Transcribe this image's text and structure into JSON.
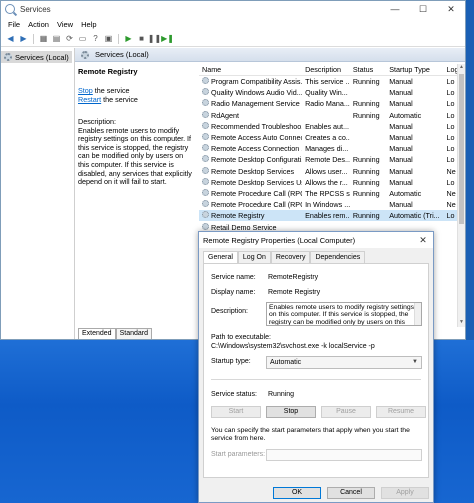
{
  "window": {
    "title": "Services",
    "controls": [
      "—",
      "☐",
      "✕"
    ]
  },
  "menu": [
    "File",
    "Action",
    "View",
    "Help"
  ],
  "tree": {
    "item": "Services (Local)"
  },
  "content_header": "Services (Local)",
  "detail": {
    "service_name": "Remote Registry",
    "stop_link": "Stop",
    "stop_rest": " the service",
    "restart_link": "Restart",
    "restart_rest": " the service",
    "desc_label": "Description:",
    "desc_text": "Enables remote users to modify registry settings on this computer. If this service is stopped, the registry can be modified only by users on this computer. If this service is disabled, any services that explicitly depend on it will fail to start."
  },
  "bottom_tabs": [
    "Extended",
    "Standard"
  ],
  "list": {
    "columns": [
      "Name",
      "Description",
      "Status",
      "Startup Type",
      "Log"
    ],
    "rows": [
      [
        "Program Compatibility Assis...",
        "This service ...",
        "Running",
        "Manual",
        "Lo"
      ],
      [
        "Quality Windows Audio Vid...",
        "Quality Win...",
        "",
        "Manual",
        "Lo"
      ],
      [
        "Radio Management Service",
        "Radio Mana...",
        "Running",
        "Manual",
        "Lo"
      ],
      [
        "RdAgent",
        "",
        "Running",
        "Automatic",
        "Lo"
      ],
      [
        "Recommended Troubleshoo...",
        "Enables aut...",
        "",
        "Manual",
        "Lo"
      ],
      [
        "Remote Access Auto Connec...",
        "Creates a co...",
        "",
        "Manual",
        "Lo"
      ],
      [
        "Remote Access Connection ...",
        "Manages di...",
        "",
        "Manual",
        "Lo"
      ],
      [
        "Remote Desktop Configurati...",
        "Remote Des...",
        "Running",
        "Manual",
        "Lo"
      ],
      [
        "Remote Desktop Services",
        "Allows user...",
        "Running",
        "Manual",
        "Ne"
      ],
      [
        "Remote Desktop Services Us...",
        "Allows the r...",
        "Running",
        "Manual",
        "Lo"
      ],
      [
        "Remote Procedure Call (RPC)",
        "The RPCSS s...",
        "Running",
        "Automatic",
        "Ne"
      ],
      [
        "Remote Procedure Call (RPC) ...",
        "In Windows ...",
        "",
        "Manual",
        "Ne"
      ],
      [
        "Remote Registry",
        "Enables rem...",
        "Running",
        "Automatic (Tri...",
        "Lo"
      ],
      [
        "Retail Demo Service",
        "",
        "",
        "",
        ""
      ]
    ],
    "selected_index": 12
  },
  "dialog": {
    "title": "Remote Registry Properties (Local Computer)",
    "close": "✕",
    "tabs": [
      "General",
      "Log On",
      "Recovery",
      "Dependencies"
    ],
    "service_name_label": "Service name:",
    "service_name_value": "RemoteRegistry",
    "display_name_label": "Display name:",
    "display_name_value": "Remote Registry",
    "description_label": "Description:",
    "description_value": "Enables remote users to modify registry settings on this computer. If this service is stopped, the registry can be modified only by users on this computer.",
    "path_label": "Path to executable:",
    "path_value": "C:\\Windows\\system32\\svchost.exe -k localService -p",
    "startup_label": "Startup type:",
    "startup_value": "Automatic",
    "status_label": "Service status:",
    "status_value": "Running",
    "btn_start": "Start",
    "btn_stop": "Stop",
    "btn_pause": "Pause",
    "btn_resume": "Resume",
    "help_text": "You can specify the start parameters that apply when you start the service from here.",
    "start_params_label": "Start parameters:",
    "ok": "OK",
    "cancel": "Cancel",
    "apply": "Apply"
  }
}
